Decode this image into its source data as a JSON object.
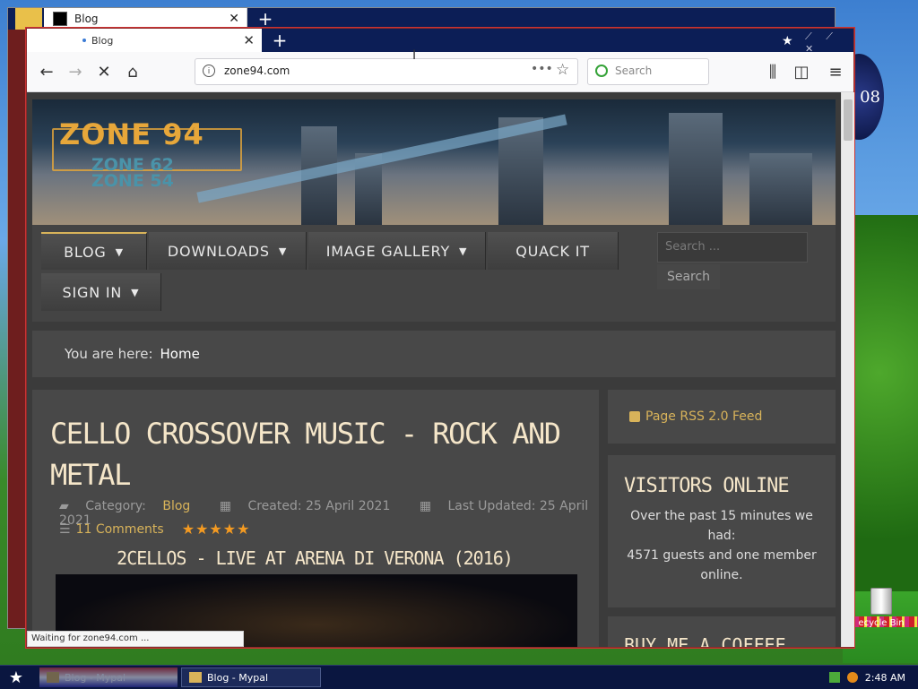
{
  "desktop": {
    "sign_text": "08",
    "recycle_label": "ecycle Bin"
  },
  "back_window": {
    "tab_title": "Blog"
  },
  "browser": {
    "tab_title": "Blog",
    "url": "zone94.com",
    "search_placeholder": "Search",
    "status_text": "Waiting for zone94.com ..."
  },
  "site": {
    "logo_main": "ZONE 94",
    "logo_sub1": "ZONE 62",
    "logo_sub2": "ZONE 54",
    "menu": [
      {
        "label": "BLOG",
        "caret": "▼"
      },
      {
        "label": "DOWNLOADS",
        "caret": "▼"
      },
      {
        "label": "IMAGE GALLERY",
        "caret": "▼"
      },
      {
        "label": "QUACK IT",
        "caret": ""
      },
      {
        "label": "SIGN IN",
        "caret": "▼"
      }
    ],
    "search_placeholder": "Search ...",
    "search_button": "Search",
    "breadcrumb_prefix": "You are here:",
    "breadcrumb_current": "Home",
    "article": {
      "title": "CELLO CROSSOVER MUSIC - ROCK AND METAL",
      "category_label": "Category:",
      "category": "Blog",
      "created": "Created: 25 April 2021",
      "updated": "Last Updated: 25 April 2021",
      "comments": "11 Comments",
      "rating_stars": "★★★★★",
      "subtitle": "2CELLOS - LIVE AT ARENA DI VERONA (2016)"
    },
    "rss": "Page RSS 2.0 Feed",
    "visitors_title": "VISITORS ONLINE",
    "visitors_line1": "Over the past 15 minutes we had:",
    "visitors_line2": "4571 guests and one member online.",
    "coffee_title": "BUY ME A COFFEE"
  },
  "taskbar": {
    "task1": "Blog - Mypal",
    "task2": "Blog - Mypal",
    "clock": "2:48 AM"
  }
}
